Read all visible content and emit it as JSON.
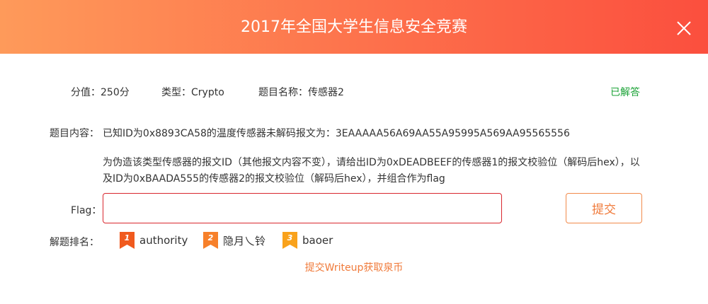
{
  "header": {
    "title": "2017年全国大学生信息安全竞赛"
  },
  "info": {
    "score": "分值：250分",
    "type": "类型：Crypto",
    "name": "题目名称：传感器2",
    "status": "已解答"
  },
  "content": {
    "label": "题目内容：",
    "line1": "已知ID为0x8893CA58的温度传感器未解码报文为：3EAAAAA56A69AA55A95995A569AA95565556",
    "paragraph": "为伪造该类型传感器的报文ID（其他报文内容不变），请给出ID为0xDEADBEEF的传感器1的报文校验位（解码后hex），以及ID为0xBAADA555的传感器2的报文校验位（解码后hex），并组合作为flag"
  },
  "flag": {
    "label": "Flag：",
    "value": "",
    "placeholder": "",
    "submit_label": "提交"
  },
  "ranking": {
    "label": "解题排名：",
    "items": [
      {
        "rank": "1",
        "name": "authority",
        "color": "#f05a1e"
      },
      {
        "rank": "2",
        "name": "隐月乀铃",
        "color": "#f7802a"
      },
      {
        "rank": "3",
        "name": "baoer",
        "color": "#f9a21b"
      }
    ]
  },
  "writeup": {
    "label": "提交Writeup获取泉币"
  },
  "colors": {
    "accent": "#fd6f4b",
    "success": "#1aa236",
    "error_border": "#d9272e"
  }
}
